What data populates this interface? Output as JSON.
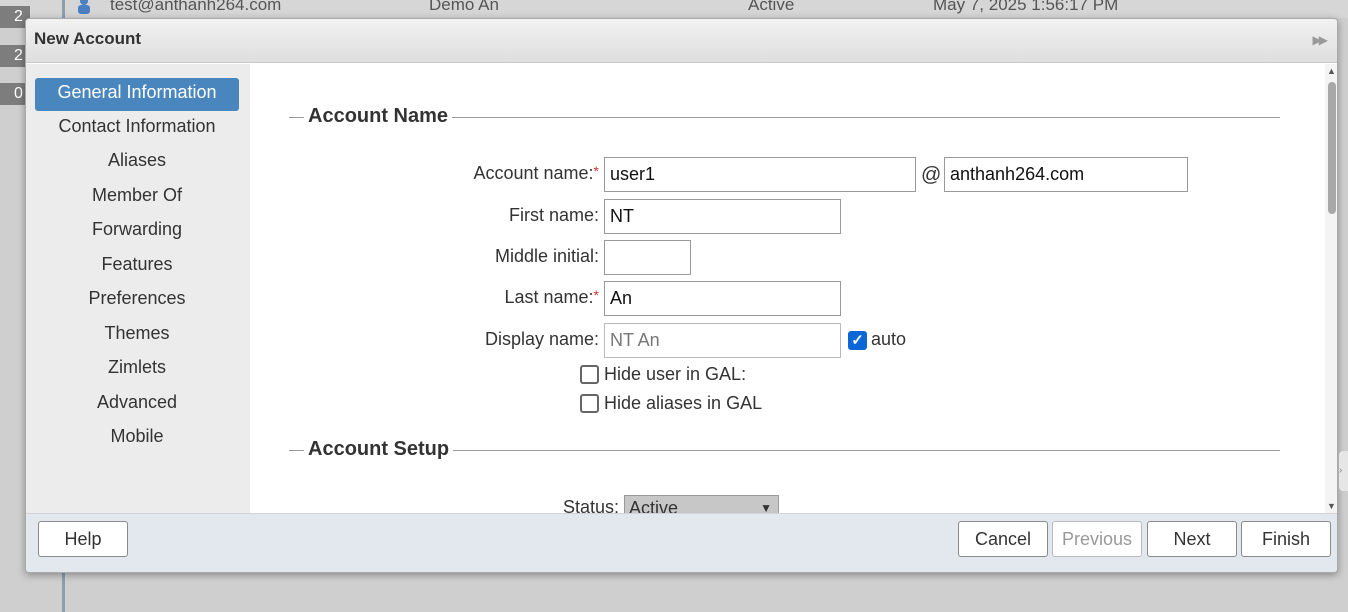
{
  "background_list": {
    "row": {
      "email": "test@anthanh264.com",
      "name": "Demo An",
      "status": "Active",
      "date": "May 7, 2025 1:56:17 PM"
    },
    "badges": [
      "2",
      "2",
      "0"
    ]
  },
  "dialog": {
    "title": "New Account",
    "expand_icon": "double-chevron-right-icon"
  },
  "sidebar": {
    "items": [
      {
        "label": "General Information",
        "selected": true
      },
      {
        "label": "Contact Information"
      },
      {
        "label": "Aliases"
      },
      {
        "label": "Member Of"
      },
      {
        "label": "Forwarding"
      },
      {
        "label": "Features"
      },
      {
        "label": "Preferences"
      },
      {
        "label": "Themes"
      },
      {
        "label": "Zimlets"
      },
      {
        "label": "Advanced"
      },
      {
        "label": "Mobile"
      }
    ]
  },
  "account_name_section": {
    "heading": "Account Name",
    "account_name_label": "Account name:",
    "account_name_value": "user1",
    "at_symbol": "@",
    "domain_value": "anthanh264.com",
    "first_name_label": "First name:",
    "first_name_value": "NT",
    "middle_initial_label": "Middle initial:",
    "middle_initial_value": "",
    "last_name_label": "Last name:",
    "last_name_value": "An",
    "display_name_label": "Display name:",
    "display_name_value": "NT An",
    "auto_label": "auto",
    "auto_checked": true,
    "hide_user_gal_label": "Hide user in GAL:",
    "hide_aliases_gal_label": "Hide aliases in GAL",
    "required_marker": "*"
  },
  "account_setup_section": {
    "heading": "Account Setup",
    "status_label": "Status:",
    "status_value": "Active"
  },
  "footer": {
    "help": "Help",
    "cancel": "Cancel",
    "previous": "Previous",
    "next": "Next",
    "finish": "Finish"
  },
  "colors": {
    "selected_nav": "#4a86be",
    "checkbox_checked": "#0b66d6",
    "required": "#cc3333"
  }
}
